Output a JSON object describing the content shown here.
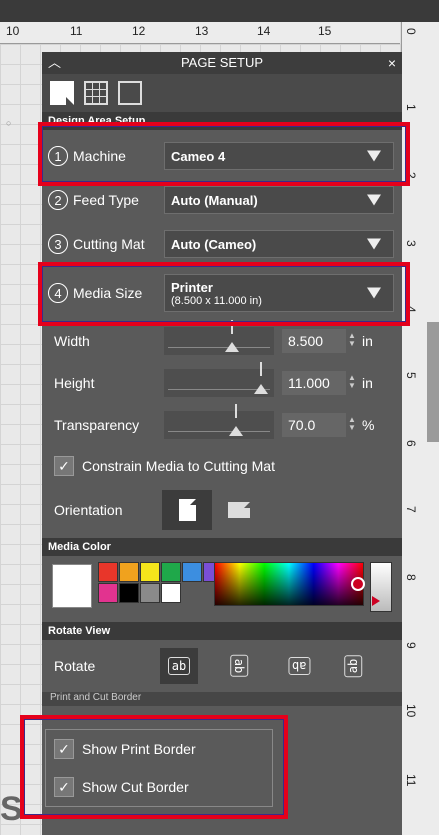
{
  "ruler": {
    "horizontal_labels": [
      "10",
      "11",
      "12",
      "13",
      "14",
      "15"
    ],
    "vertical_labels": [
      "0",
      "1",
      "2",
      "3",
      "4",
      "5",
      "6",
      "7",
      "8",
      "9",
      "10",
      "11"
    ]
  },
  "panel": {
    "title": "PAGE SETUP",
    "collapse_icon": "chevron-up",
    "close_icon": "close",
    "tabs": [
      {
        "name": "page-tab",
        "icon": "page"
      },
      {
        "name": "grid-tab",
        "icon": "grid"
      },
      {
        "name": "registration-tab",
        "icon": "corners"
      }
    ]
  },
  "design_area": {
    "section_title": "Design Area Setup",
    "machine": {
      "step": "1",
      "label": "Machine",
      "value": "Cameo 4"
    },
    "feed_type": {
      "step": "2",
      "label": "Feed Type",
      "value": "Auto (Manual)"
    },
    "cutting_mat": {
      "step": "3",
      "label": "Cutting Mat",
      "value": "Auto (Cameo)"
    },
    "media_size": {
      "step": "4",
      "label": "Media Size",
      "value": "Printer",
      "sub_value": "(8.500 x 11.000 in)"
    },
    "width": {
      "label": "Width",
      "value": "8.500",
      "unit": "in",
      "slider_fraction": 0.62
    },
    "height": {
      "label": "Height",
      "value": "11.000",
      "unit": "in",
      "slider_fraction": 0.88
    },
    "transparency": {
      "label": "Transparency",
      "value": "70.0",
      "unit": "%",
      "slider_fraction": 0.65
    },
    "constrain": {
      "label": "Constrain Media to Cutting Mat",
      "checked": true
    },
    "orientation": {
      "label": "Orientation",
      "selected": "portrait"
    }
  },
  "media_color": {
    "section_title": "Media Color",
    "current": "#ffffff",
    "swatches": [
      "#e8362a",
      "#f0a21e",
      "#f5e51b",
      "#1fa84a",
      "#3c8ee0",
      "#7a4fd6",
      "#e2338f",
      "#000000",
      "#8a8a8a",
      "#ffffff"
    ]
  },
  "rotate_view": {
    "section_title": "Rotate View",
    "label": "Rotate",
    "options": [
      "ab",
      "ab",
      "ab",
      "ab"
    ],
    "selected": 0
  },
  "print_cut": {
    "section_title": "Print and Cut Border",
    "show_print_border": {
      "label": "Show Print Border",
      "checked": true
    },
    "show_cut_border": {
      "label": "Show Cut Border",
      "checked": true
    }
  },
  "colors": {
    "panel_bg": "#5a5a5a",
    "highlight": "#e5001b"
  }
}
